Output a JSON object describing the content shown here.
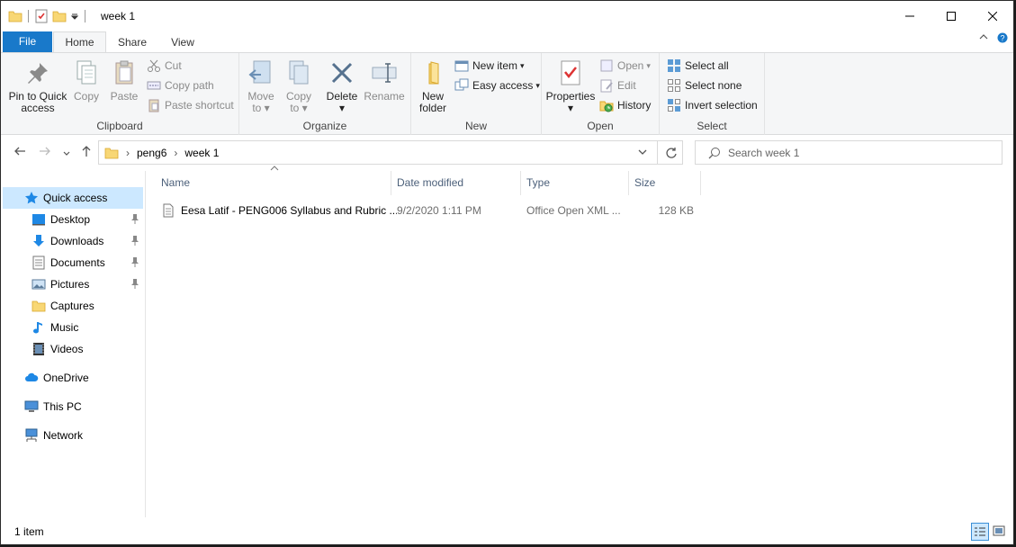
{
  "window": {
    "title": "week 1",
    "minimize_glyph": "—",
    "maximize_glyph": "☐",
    "close_glyph": "✕"
  },
  "ribbon_tabs": {
    "file": "File",
    "home": "Home",
    "share": "Share",
    "view": "View"
  },
  "ribbon": {
    "clipboard": {
      "label": "Clipboard",
      "pin_line1": "Pin to Quick",
      "pin_line2": "access",
      "copy": "Copy",
      "paste": "Paste",
      "cut": "Cut",
      "copy_path": "Copy path",
      "paste_shortcut": "Paste shortcut"
    },
    "organize": {
      "label": "Organize",
      "move_to_line1": "Move",
      "move_to_line2": "to",
      "copy_to_line1": "Copy",
      "copy_to_line2": "to",
      "delete": "Delete",
      "rename": "Rename"
    },
    "new": {
      "label": "New",
      "new_folder_line1": "New",
      "new_folder_line2": "folder",
      "new_item": "New item",
      "easy_access": "Easy access"
    },
    "open": {
      "label": "Open",
      "properties": "Properties",
      "open": "Open",
      "edit": "Edit",
      "history": "History"
    },
    "select": {
      "label": "Select",
      "select_all": "Select all",
      "select_none": "Select none",
      "invert_selection": "Invert selection"
    }
  },
  "address": {
    "crumbs": [
      "peng6",
      "week 1"
    ],
    "search_placeholder": "Search week 1"
  },
  "nav_pane": {
    "quick_access": "Quick access",
    "items": [
      {
        "label": "Desktop",
        "pinned": true
      },
      {
        "label": "Downloads",
        "pinned": true
      },
      {
        "label": "Documents",
        "pinned": true
      },
      {
        "label": "Pictures",
        "pinned": true
      },
      {
        "label": "Captures",
        "pinned": false
      },
      {
        "label": "Music",
        "pinned": false
      },
      {
        "label": "Videos",
        "pinned": false
      }
    ],
    "onedrive": "OneDrive",
    "this_pc": "This PC",
    "network": "Network"
  },
  "file_list": {
    "columns": [
      "Name",
      "Date modified",
      "Type",
      "Size"
    ],
    "rows": [
      {
        "name": "Eesa Latif - PENG006 Syllabus and Rubric ...",
        "date": "9/2/2020 1:11 PM",
        "type": "Office Open XML ...",
        "size": "128 KB"
      }
    ]
  },
  "status": {
    "item_count": "1 item"
  },
  "colors": {
    "file_tab": "#1979ca",
    "selection": "#cce8ff",
    "folder": "#f8d775"
  }
}
